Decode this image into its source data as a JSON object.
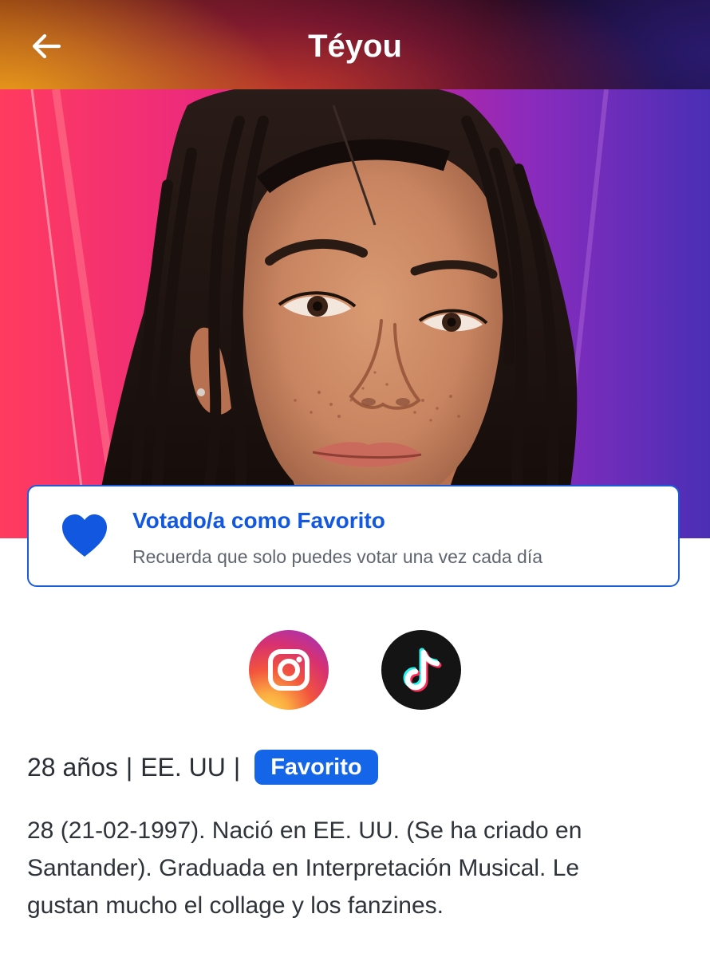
{
  "header": {
    "title": "Téyou",
    "back_icon": "arrow-left-icon"
  },
  "hero": {
    "alt": "Téyou"
  },
  "vote_card": {
    "title": "Votado/a como Favorito",
    "subtitle": "Recuerda que solo puedes votar una vez cada día",
    "icon": "heart-icon",
    "accent_color": "#1257e0"
  },
  "social": [
    {
      "name": "Instagram",
      "icon": "instagram-icon"
    },
    {
      "name": "TikTok",
      "icon": "tiktok-icon"
    }
  ],
  "info": {
    "age": "28 años",
    "country": "EE. UU",
    "separator": "|",
    "badge": "Favorito",
    "badge_color": "#1565e8"
  },
  "bio": "28 (21-02-1997). Nació en EE. UU. (Se ha criado en Santander). Graduada en Interpretación Musical. Le gustan mucho el collage y los fanzines."
}
